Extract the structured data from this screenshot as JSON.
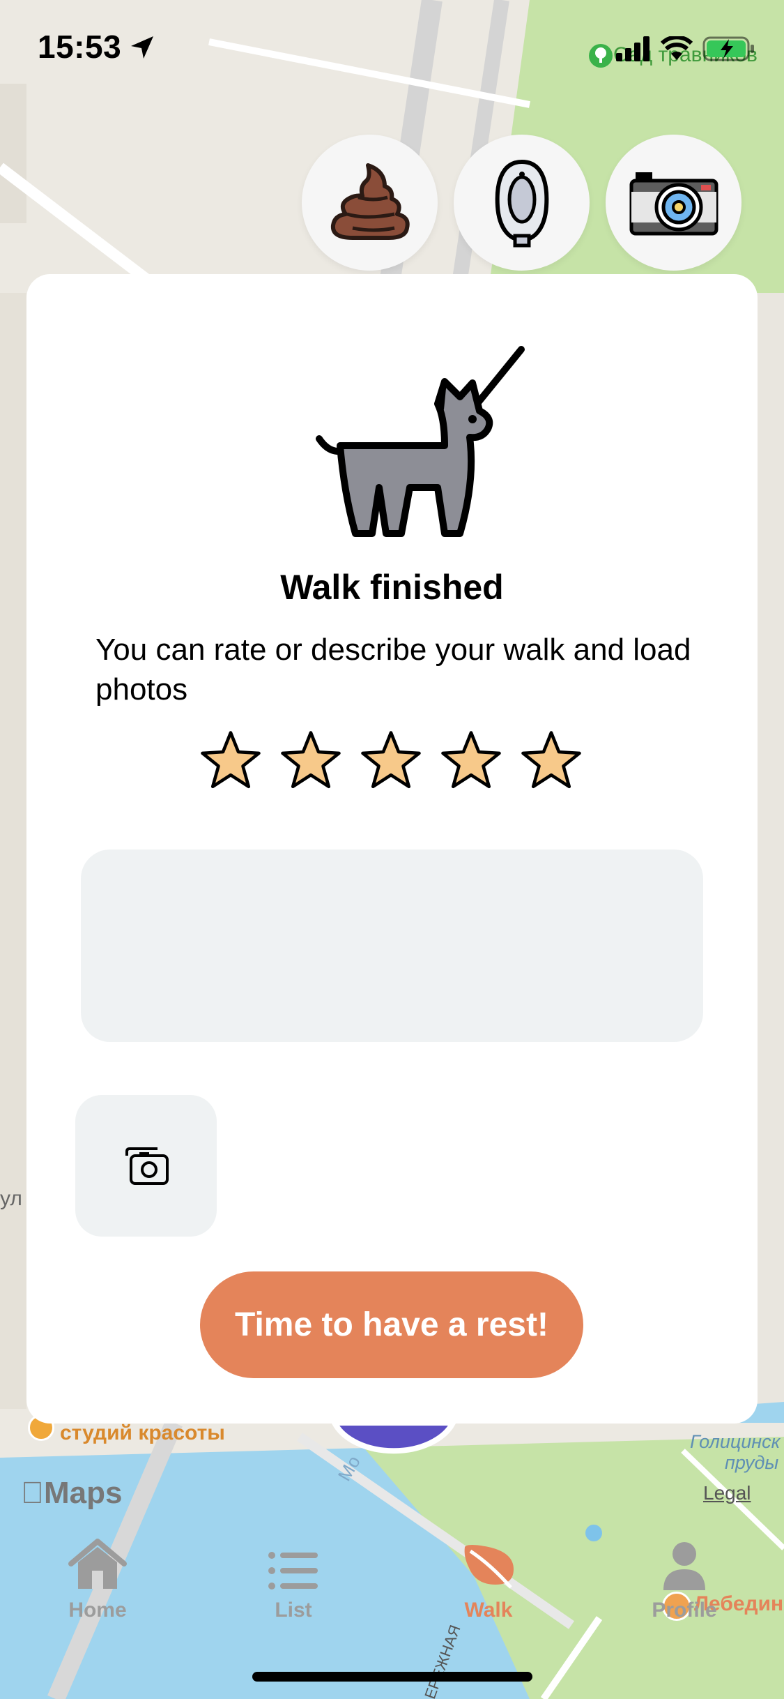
{
  "status_bar": {
    "time": "15:53"
  },
  "map": {
    "labels": {
      "garden": "Сад травников",
      "beauty": "студий красоты",
      "ponds_1": "Голицинск",
      "ponds_2": "пруды",
      "restaurant": "Лебедин",
      "street_1": "Мо",
      "street_2": "ЕРЕЖНАЯ",
      "street_3": "ул",
      "legal": "Legal",
      "maps_brand": "Maps"
    },
    "colors": {
      "land": "#ece9e2",
      "water": "#9fd4ee",
      "park": "#c6e3a7"
    }
  },
  "actions": [
    {
      "name": "poop-icon"
    },
    {
      "name": "urinal-icon"
    },
    {
      "name": "camera-icon"
    }
  ],
  "card": {
    "title": "Walk finished",
    "subtitle": "You can rate or describe your walk and load photos",
    "rating": {
      "value": 5,
      "max": 5
    },
    "description": {
      "value": "",
      "placeholder": ""
    },
    "rest_button": "Time to have a rest!"
  },
  "tabs": [
    {
      "label": "Home",
      "active": false
    },
    {
      "label": "List",
      "active": false
    },
    {
      "label": "Walk",
      "active": true
    },
    {
      "label": "Profile",
      "active": false
    }
  ],
  "colors": {
    "accent": "#e4845a",
    "star_fill": "#f7c98a",
    "tab_inactive": "#9c9c9c",
    "input_bg": "#eff2f3"
  }
}
